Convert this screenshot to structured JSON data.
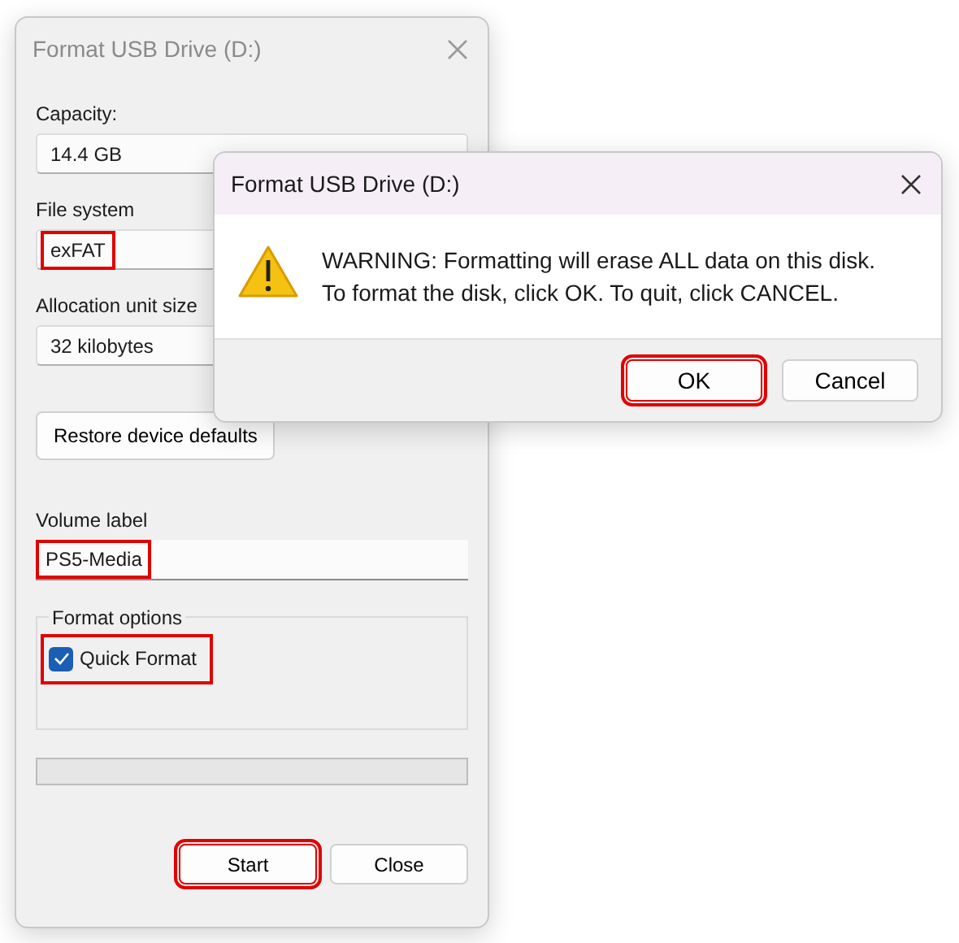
{
  "format_window": {
    "title": "Format USB Drive (D:)",
    "active": false,
    "fields": [
      {
        "kind": "dropdown",
        "label": "Capacity:",
        "value": "14.4 GB",
        "highlighted": false
      },
      {
        "kind": "dropdown",
        "label": "File system",
        "value": "exFAT",
        "highlighted": true
      },
      {
        "kind": "dropdown",
        "label": "Allocation unit size",
        "value": "32 kilobytes",
        "highlighted": false
      }
    ],
    "restore_button": "Restore device defaults",
    "volume_label": {
      "label": "Volume label",
      "value": "PS5-Media",
      "highlighted": true
    },
    "format_options": {
      "title": "Format options",
      "options": [
        {
          "label": "Quick Format",
          "checked": true,
          "highlighted": true
        }
      ]
    },
    "progress": {
      "level": 0
    },
    "buttons": [
      {
        "label": "Start",
        "highlighted": true
      },
      {
        "label": "Close",
        "highlighted": false
      }
    ]
  },
  "alert": {
    "title": "Format USB Drive (D:)",
    "active": true,
    "message": [
      "WARNING: Formatting will erase ALL data on this disk.",
      "To format the disk, click OK. To quit, click CANCEL."
    ],
    "buttons": [
      {
        "label": "OK",
        "highlighted": true
      },
      {
        "label": "Cancel",
        "highlighted": false
      }
    ]
  }
}
